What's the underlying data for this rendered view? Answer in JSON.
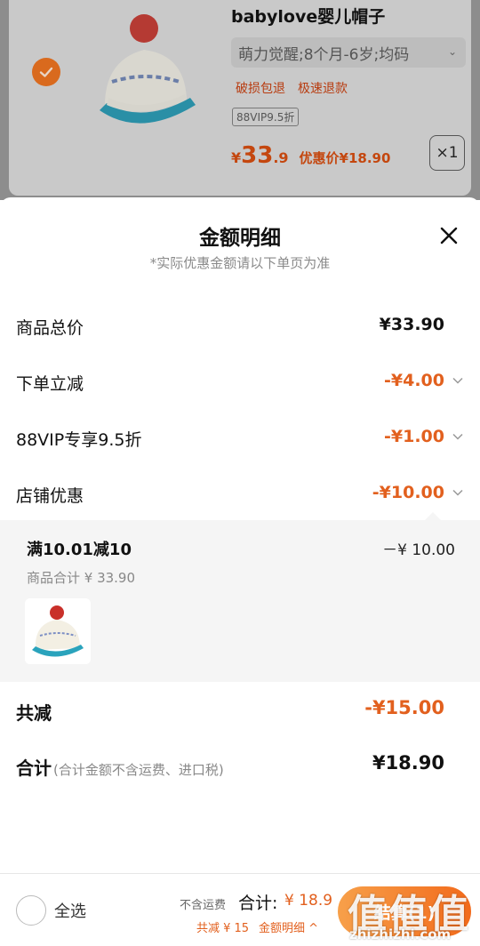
{
  "cart": {
    "title": "babylove婴儿帽子",
    "spec": "萌力觉醒;8个月-6岁;均码",
    "tags": [
      "破损包退",
      "极速退款"
    ],
    "vip_tag": "88VIP9.5折",
    "price_currency": "¥",
    "price_int": "33",
    "price_dec": ".9",
    "discount_price": "优惠价¥18.90",
    "qty": "×1"
  },
  "sheet": {
    "title": "金额明细",
    "subtitle": "*实际优惠金额请以下单页为准",
    "rows": [
      {
        "label": "商品总价",
        "value": "¥33.90"
      },
      {
        "label": "下单立减",
        "value": "-¥4.00"
      },
      {
        "label": "88VIP专享9.5折",
        "value": "-¥1.00"
      },
      {
        "label": "店铺优惠",
        "value": "-¥10.00"
      }
    ],
    "detail": {
      "title": "满10.01减10",
      "amount": "－¥ 10.00",
      "subtotal": "商品合计 ¥ 33.90"
    },
    "total_reduce": {
      "label": "共减",
      "value": "-¥15.00"
    },
    "total": {
      "label": "合计",
      "note": "(合计金额不含运费、进口税)",
      "value": "¥18.90"
    }
  },
  "bottom": {
    "select_all": "全选",
    "shipping_note": "不含运费",
    "sum_label": "合计:",
    "sum_value": "¥ 18.9",
    "savings": "共减 ¥ 15",
    "detail_link": "金额明细 ^",
    "checkout": "结算(1)"
  },
  "watermark": {
    "glyphs": "值值值",
    "url": "zhizhizhi.com"
  }
}
